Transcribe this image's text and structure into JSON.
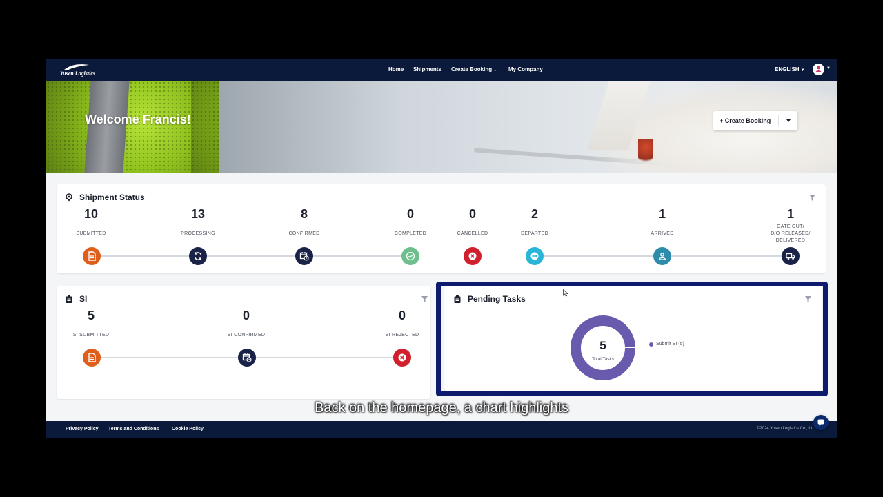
{
  "nav": {
    "logo_text": "Yusen Logistics",
    "links": [
      "Home",
      "Shipments",
      "Create Booking",
      "My Company"
    ],
    "language": "ENGLISH"
  },
  "hero": {
    "welcome": "Welcome Francis!",
    "create_booking": "+ Create Booking"
  },
  "shipment_status": {
    "title": "Shipment Status",
    "stats": [
      {
        "value": "10",
        "label": "SUBMITTED",
        "color": "#dd5f1b",
        "icon": "document-icon"
      },
      {
        "value": "13",
        "label": "PROCESSING",
        "color": "#1a2347",
        "icon": "refresh-icon"
      },
      {
        "value": "8",
        "label": "CONFIRMED",
        "color": "#1a2347",
        "icon": "calendar-clock-icon"
      },
      {
        "value": "0",
        "label": "COMPLETED",
        "color": "#6fbf8e",
        "icon": "check-icon"
      },
      {
        "value": "0",
        "label": "CANCELLED",
        "color": "#d01f2d",
        "icon": "x-icon"
      },
      {
        "value": "2",
        "label": "DEPARTED",
        "color": "#2ab5d8",
        "icon": "arrows-icon"
      },
      {
        "value": "1",
        "label": "ARRIVED",
        "color": "#2d8ca9",
        "icon": "person-icon"
      },
      {
        "value": "1",
        "label_lines": [
          "GATE OUT/",
          "D/O RELEASED/",
          "DELIVERED"
        ],
        "color": "#1a2347",
        "icon": "truck-icon"
      }
    ]
  },
  "si": {
    "title": "SI",
    "stats": [
      {
        "value": "5",
        "label": "SI SUBMITTED",
        "color": "#dd5f1b",
        "icon": "document-icon"
      },
      {
        "value": "0",
        "label": "SI CONFIRMED",
        "color": "#1a2347",
        "icon": "calendar-clock-icon"
      },
      {
        "value": "0",
        "label": "SI REJECTED",
        "color": "#d01f2d",
        "icon": "x-icon"
      }
    ]
  },
  "pending_tasks": {
    "title": "Pending Tasks",
    "total": "5",
    "total_label": "Total Tasks",
    "legend": "Submit SI (5)",
    "color": "#6a5aad"
  },
  "chart_data": {
    "type": "pie",
    "title": "Pending Tasks",
    "categories": [
      "Submit SI (5)"
    ],
    "values": [
      5
    ]
  },
  "footer": {
    "links": [
      "Privacy Policy",
      "Terms and Conditions",
      "Cookie Policy"
    ],
    "copyright": "©2024 Yusen Logistics Co., Lt..."
  },
  "subtitle": "Back on the homepage, a chart highlights"
}
